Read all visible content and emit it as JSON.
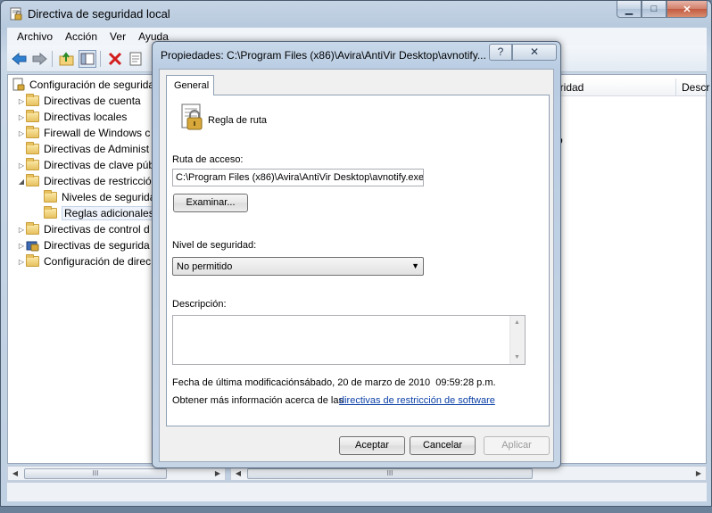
{
  "window": {
    "title": "Directiva de seguridad local",
    "minimize_glyph": "▁",
    "maximize_glyph": "□",
    "close_glyph": "✕"
  },
  "menu": [
    "Archivo",
    "Acción",
    "Ver",
    "Ayuda"
  ],
  "toolbar_icons": [
    "back-icon",
    "forward-icon",
    "up-folder-icon",
    "show-hide-tree-icon",
    "delete-icon",
    "properties-icon"
  ],
  "tree": [
    {
      "label": "Configuración de segurida",
      "expander": "",
      "indent": 0
    },
    {
      "label": "Directivas de cuenta",
      "expander": "▷",
      "indent": 1
    },
    {
      "label": "Directivas locales",
      "expander": "▷",
      "indent": 1
    },
    {
      "label": "Firewall de Windows c",
      "expander": "▷",
      "indent": 1
    },
    {
      "label": "Directivas de Administ",
      "expander": "",
      "indent": 1
    },
    {
      "label": "Directivas de clave púb",
      "expander": "▷",
      "indent": 1
    },
    {
      "label": "Directivas de restricció",
      "expander": "◢",
      "indent": 1
    },
    {
      "label": "Niveles de segurida",
      "expander": "",
      "indent": 2
    },
    {
      "label": "Reglas adicionales",
      "expander": "",
      "indent": 2
    },
    {
      "label": "Directivas de control d",
      "expander": "▷",
      "indent": 1
    },
    {
      "label": "Directivas de segurida",
      "expander": "▷",
      "indent": 1
    },
    {
      "label": "Configuración de direc",
      "expander": "▷",
      "indent": 1
    }
  ],
  "list": {
    "col_security": "uridad",
    "col_description": "Descr",
    "row_fragment": "o"
  },
  "scroll": {
    "left_arrow": "◀",
    "right_arrow": "▶",
    "up_arrow": "▲",
    "down_arrow": "▼",
    "grip": "III"
  },
  "dialog": {
    "title": "Propiedades: C:\\Program Files (x86)\\Avira\\AntiVir Desktop\\avnotify...",
    "help": "?",
    "close": "✕",
    "tab": "General",
    "rule_name": "Regla de ruta",
    "path_label": "Ruta de acceso:",
    "path_value": "C:\\Program Files (x86)\\Avira\\AntiVir Desktop\\avnotify.exe",
    "browse_button": "Examinar...",
    "security_level_label": "Nivel de seguridad:",
    "security_level_value": "No permitido",
    "description_label": "Descripción:",
    "description_value": "",
    "modified_label": "Fecha de última modificación:",
    "modified_value": "sábado, 20 de marzo de 2010  09:59:28 p.m.",
    "more_info_text": "Obtener más información acerca de las",
    "more_info_link": "directivas de restricción de software",
    "ok_button": "Aceptar",
    "cancel_button": "Cancelar",
    "apply_button": "Aplicar"
  }
}
